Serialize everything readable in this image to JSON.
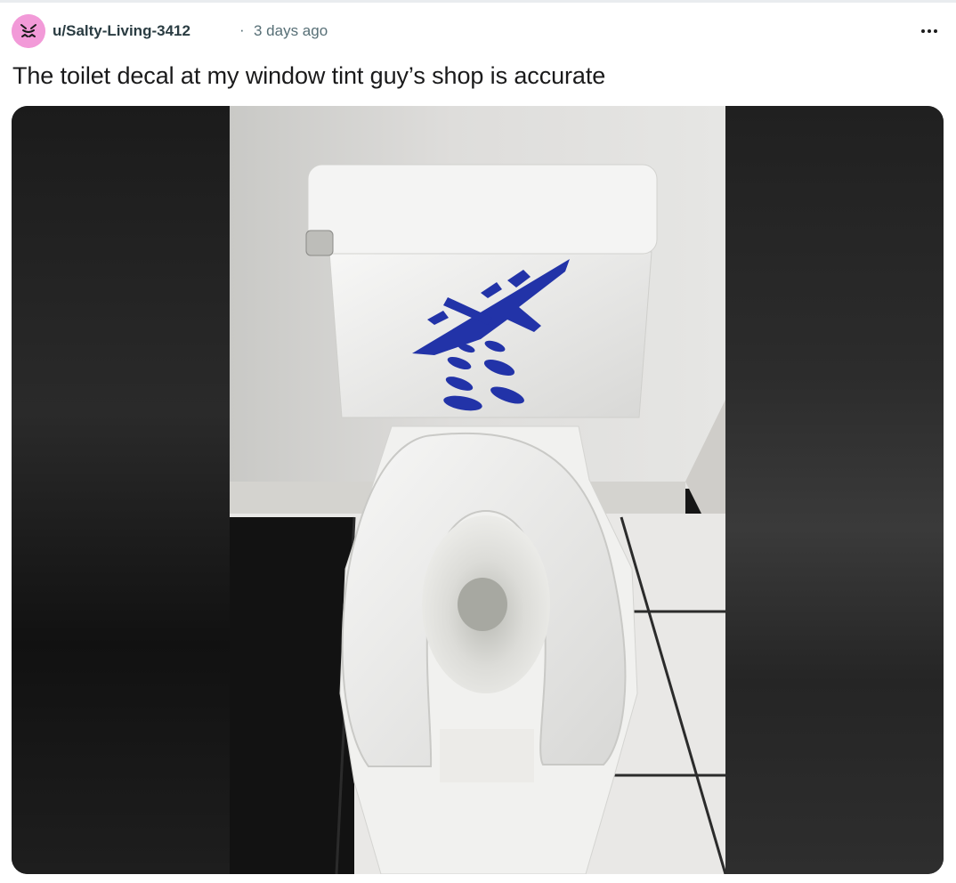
{
  "post": {
    "author": "u/Salty-Living-3412",
    "separator": "·",
    "time_ago": "3 days ago",
    "title": "The toilet decal at my window tint guy’s shop is accurate"
  },
  "icons": {
    "avatar": "avatar-icon",
    "overflow": "more-options-icon"
  },
  "colors": {
    "avatar_bg": "#f29ad8",
    "decal": "#2233a8"
  }
}
